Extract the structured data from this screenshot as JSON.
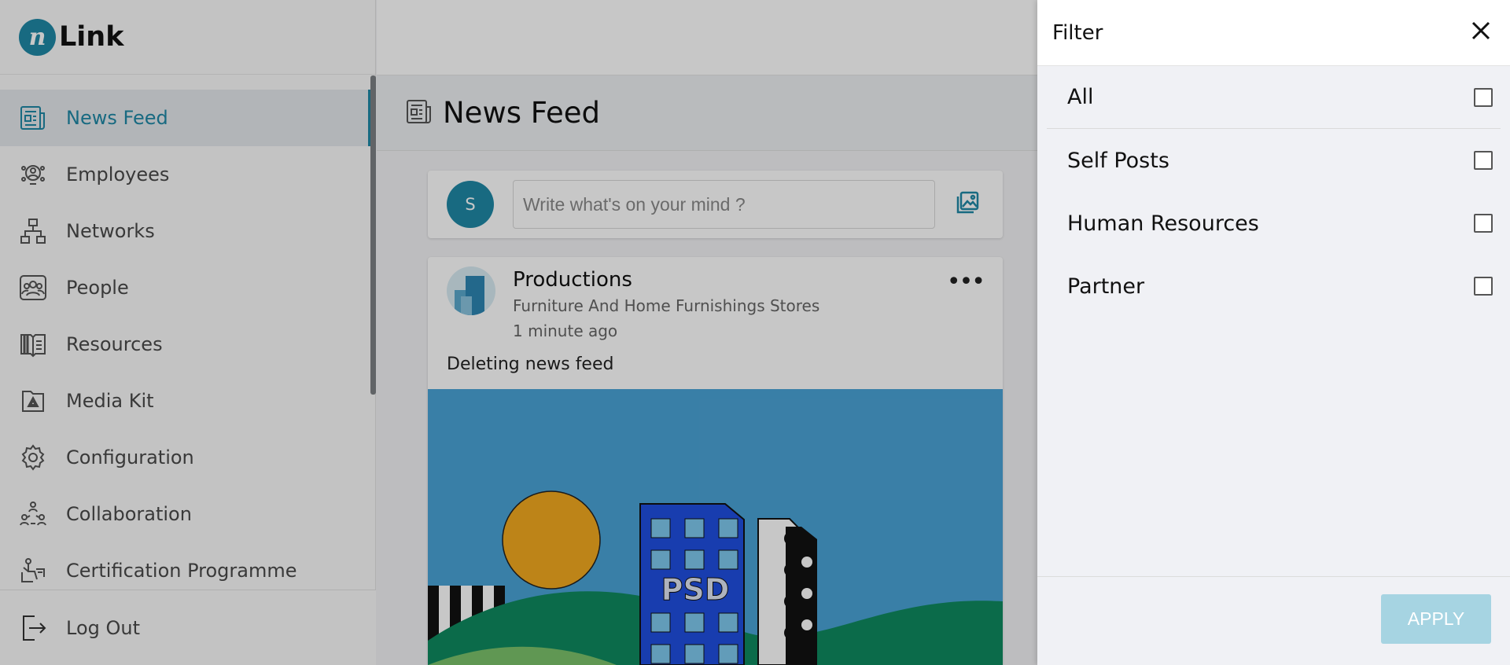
{
  "app": {
    "logo_mark": "n",
    "logo_text": "Link"
  },
  "sidebar": {
    "items": [
      {
        "label": "News Feed",
        "icon": "newspaper-icon"
      },
      {
        "label": "Employees",
        "icon": "employees-icon"
      },
      {
        "label": "Networks",
        "icon": "network-icon"
      },
      {
        "label": "People",
        "icon": "people-icon"
      },
      {
        "label": "Resources",
        "icon": "book-icon"
      },
      {
        "label": "Media Kit",
        "icon": "media-kit-icon"
      },
      {
        "label": "Configuration",
        "icon": "gear-icon"
      },
      {
        "label": "Collaboration",
        "icon": "collaboration-icon"
      },
      {
        "label": "Certification Programme",
        "icon": "certification-icon"
      }
    ],
    "logout_label": "Log Out"
  },
  "page": {
    "title": "News Feed"
  },
  "composer": {
    "avatar_initial": "S",
    "placeholder": "Write what's on your mind ?"
  },
  "post": {
    "author": "Productions",
    "category": "Furniture And Home Furnishings Stores",
    "time": "1 minute ago",
    "text": "Deleting news feed",
    "menu_label": "•••",
    "image_text": "PSD"
  },
  "filter": {
    "title": "Filter",
    "options": [
      {
        "label": "All",
        "checked": false
      },
      {
        "label": "Self Posts",
        "checked": false
      },
      {
        "label": "Human Resources",
        "checked": false
      },
      {
        "label": "Partner",
        "checked": false
      }
    ],
    "apply_label": "APPLY"
  },
  "colors": {
    "accent": "#1f88a6",
    "apply_disabled": "#a6d4e2"
  }
}
